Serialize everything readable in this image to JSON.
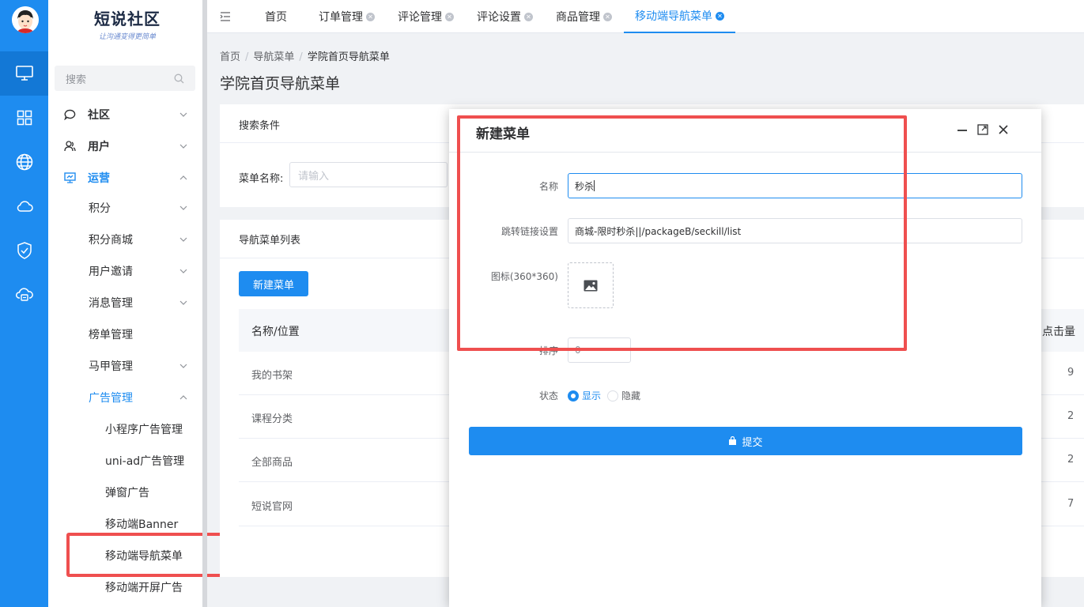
{
  "sidebar": {
    "brand_title": "短说社区",
    "brand_subtitle": "让沟通变得更简单",
    "search_placeholder": "搜索",
    "items": [
      {
        "label": "社区"
      },
      {
        "label": "用户"
      },
      {
        "label": "运营"
      },
      {
        "label": "积分"
      },
      {
        "label": "积分商城"
      },
      {
        "label": "用户邀请"
      },
      {
        "label": "消息管理"
      },
      {
        "label": "榜单管理"
      },
      {
        "label": "马甲管理"
      },
      {
        "label": "广告管理"
      },
      {
        "label": "小程序广告管理"
      },
      {
        "label": "uni-ad广告管理"
      },
      {
        "label": "弹窗广告"
      },
      {
        "label": "移动端Banner"
      },
      {
        "label": "移动端导航菜单"
      },
      {
        "label": "移动端开屏广告"
      }
    ]
  },
  "tabs": [
    {
      "label": "首页"
    },
    {
      "label": "订单管理"
    },
    {
      "label": "评论管理"
    },
    {
      "label": "评论设置"
    },
    {
      "label": "商品管理"
    },
    {
      "label": "移动端导航菜单"
    }
  ],
  "breadcrumb": [
    "首页",
    "导航菜单",
    "学院首页导航菜单"
  ],
  "page_title": "学院首页导航菜单",
  "search_card": {
    "title": "搜索条件",
    "field_label": "菜单名称:",
    "field_placeholder": "请输入"
  },
  "list_card": {
    "title": "导航菜单列表",
    "new_button": "新建菜单",
    "col_name": "名称/位置",
    "col_clicks": "点击量",
    "rows": [
      {
        "name": "我的书架",
        "clicks": "9"
      },
      {
        "name": "课程分类",
        "clicks": "2"
      },
      {
        "name": "全部商品",
        "clicks": "2"
      },
      {
        "name": "短说官网",
        "clicks": "7"
      }
    ]
  },
  "modal": {
    "title": "新建菜单",
    "name_label": "名称",
    "name_value": "秒杀",
    "link_label": "跳转链接设置",
    "link_value": "商城-限时秒杀||/packageB/seckill/list",
    "icon_label": "图标(360*360)",
    "sort_label": "排序",
    "sort_value": "0",
    "status_label": "状态",
    "status_options": [
      "显示",
      "隐藏"
    ],
    "status_selected": "显示",
    "submit_label": "提交"
  },
  "colors": {
    "accent": "#1e8cf0",
    "highlight": "#ef4f4f"
  }
}
